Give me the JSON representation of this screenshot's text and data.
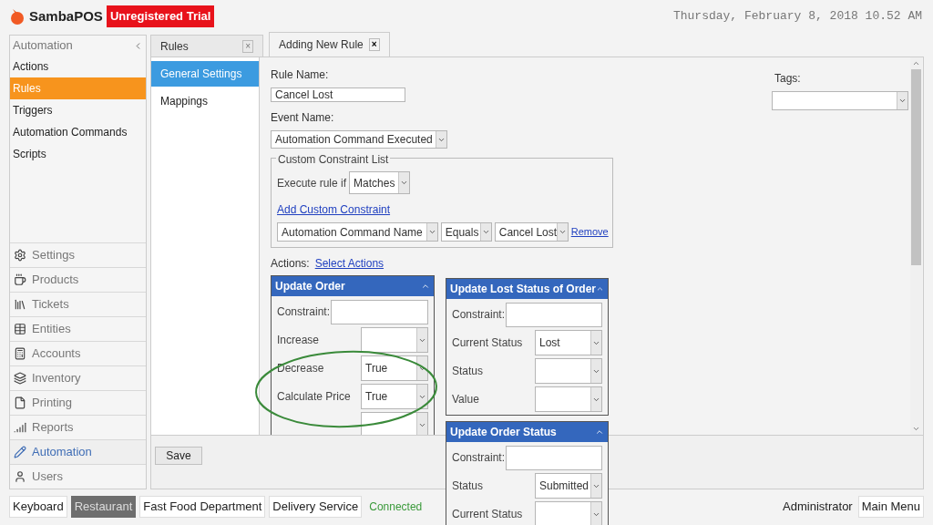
{
  "header": {
    "brand": "SambaPOS",
    "badge": "Unregistered Trial",
    "datetime": "Thursday, February 8, 2018 10.52 AM"
  },
  "sidebar": {
    "title": "Automation",
    "items": [
      {
        "label": "Actions",
        "selected": false
      },
      {
        "label": "Rules",
        "selected": true
      },
      {
        "label": "Triggers",
        "selected": false
      },
      {
        "label": "Automation Commands",
        "selected": false
      },
      {
        "label": "Scripts",
        "selected": false
      }
    ],
    "modules": [
      {
        "label": "Settings",
        "selected": false
      },
      {
        "label": "Products",
        "selected": false
      },
      {
        "label": "Tickets",
        "selected": false
      },
      {
        "label": "Entities",
        "selected": false
      },
      {
        "label": "Accounts",
        "selected": false
      },
      {
        "label": "Inventory",
        "selected": false
      },
      {
        "label": "Printing",
        "selected": false
      },
      {
        "label": "Reports",
        "selected": false
      },
      {
        "label": "Automation",
        "selected": true
      },
      {
        "label": "Users",
        "selected": false
      }
    ]
  },
  "tabs": [
    {
      "label": "Rules",
      "close": "×",
      "selected": false
    },
    {
      "label": "Adding New Rule",
      "close": "×",
      "selected": true
    }
  ],
  "subnav": [
    {
      "label": "General Settings",
      "selected": true
    },
    {
      "label": "Mappings",
      "selected": false
    }
  ],
  "form": {
    "rule_name_label": "Rule Name:",
    "rule_name": "Cancel Lost",
    "event_label": "Event Name:",
    "event_name": "Automation Command Executed",
    "tags_label": "Tags:",
    "constraints": {
      "legend": "Custom Constraint List",
      "execute_label": "Execute rule if",
      "execute_value": "Matches",
      "add_link": "Add Custom Constraint",
      "row": {
        "field": "Automation Command Name",
        "operator": "Equals",
        "value": "Cancel Lost",
        "remove": "Remove"
      }
    },
    "actions_label": "Actions:",
    "select_actions": "Select Actions",
    "cards": [
      {
        "title": "Update Order",
        "fields": [
          {
            "kind": "text",
            "label": "Constraint:"
          },
          {
            "kind": "select",
            "label": "Increase"
          },
          {
            "kind": "select",
            "label": "Decrease",
            "value": "True"
          },
          {
            "kind": "select",
            "label": "Calculate Price",
            "value": "True"
          },
          {
            "kind": "select"
          }
        ]
      },
      {
        "title": "Update Lost Status of Order",
        "fields": [
          {
            "kind": "text",
            "label": "Constraint:"
          },
          {
            "kind": "select",
            "label": "Current Status",
            "value": "Lost"
          },
          {
            "kind": "select",
            "label": "Status"
          },
          {
            "kind": "select",
            "label": "Value"
          }
        ]
      },
      {
        "title": "Update Order Status",
        "fields": [
          {
            "kind": "text",
            "label": "Constraint:"
          },
          {
            "kind": "select",
            "label": "Status",
            "value": "Submitted"
          },
          {
            "kind": "select",
            "label": "Current Status"
          }
        ]
      }
    ]
  },
  "save": "Save",
  "bottom": {
    "departments": [
      {
        "label": "Keyboard",
        "selected": false
      },
      {
        "label": "Restaurant",
        "selected": true
      },
      {
        "label": "Fast Food Department",
        "selected": false
      },
      {
        "label": "Delivery Service",
        "selected": false
      }
    ],
    "status": "Connected",
    "user": "Administrator",
    "main_menu": "Main Menu"
  }
}
